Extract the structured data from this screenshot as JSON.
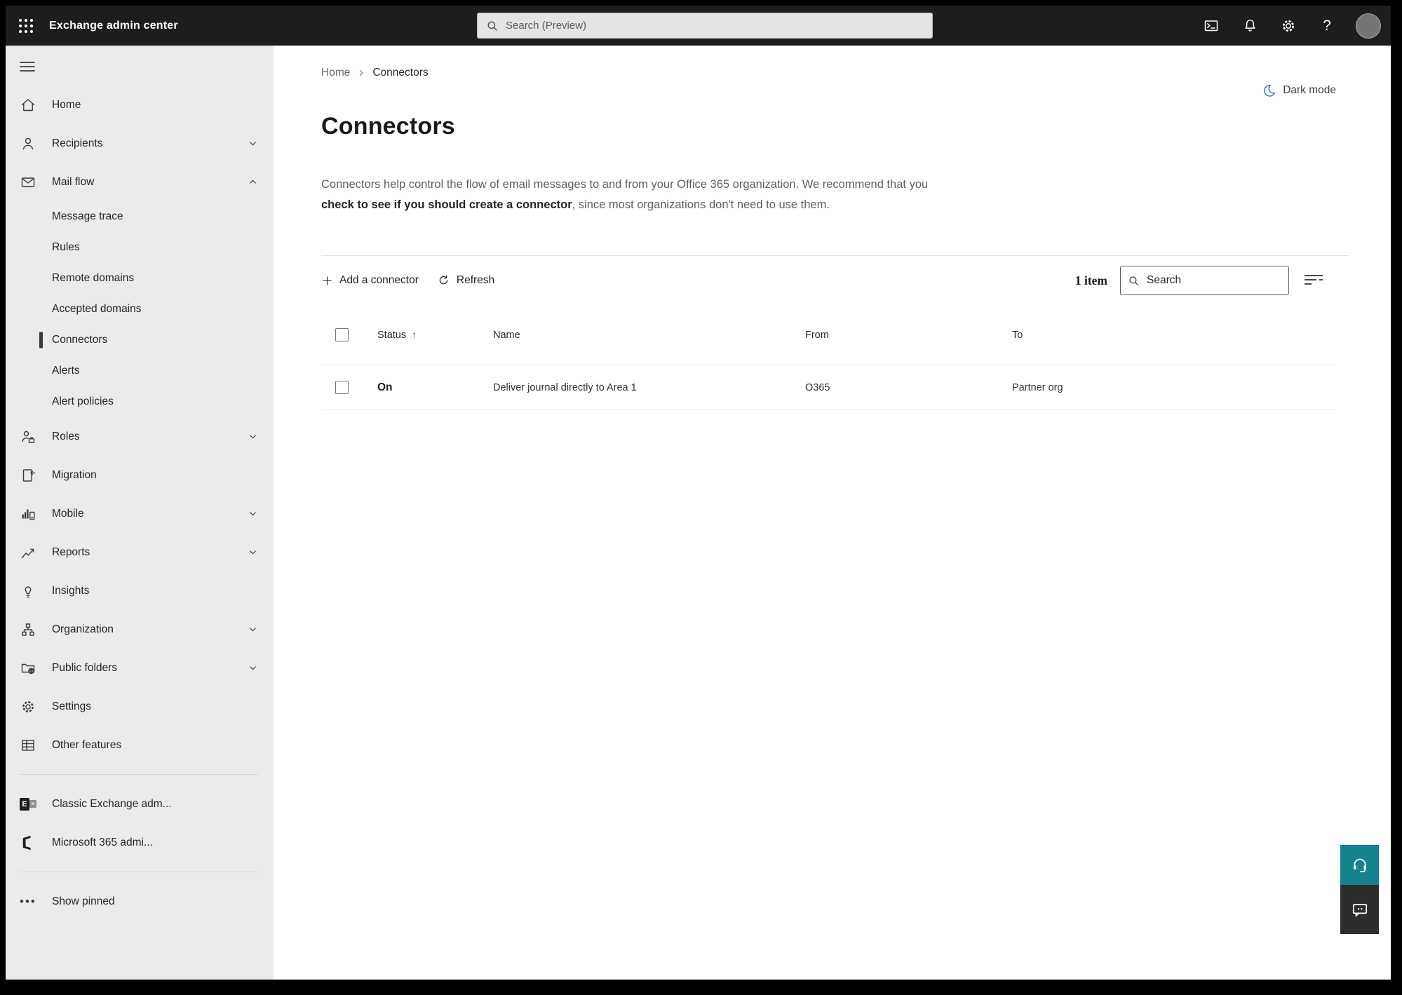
{
  "colors": {
    "topbar_bg": "#1d1d1d",
    "sidebar_bg": "#ebebeb",
    "selected_marker": "#3a3a3a",
    "accent_teal": "#13838e",
    "darkmode_blue": "#2f6fd6"
  },
  "topbar": {
    "title": "Exchange admin center",
    "search_placeholder": "Search (Preview)",
    "help_glyph": "?"
  },
  "sidebar": {
    "items": [
      {
        "label": "Home"
      },
      {
        "label": "Recipients"
      },
      {
        "label": "Mail flow"
      },
      {
        "label": "Message trace"
      },
      {
        "label": "Rules"
      },
      {
        "label": "Remote domains"
      },
      {
        "label": "Accepted domains"
      },
      {
        "label": "Connectors",
        "selected": true
      },
      {
        "label": "Alerts"
      },
      {
        "label": "Alert policies"
      },
      {
        "label": "Roles"
      },
      {
        "label": "Migration"
      },
      {
        "label": "Mobile"
      },
      {
        "label": "Reports"
      },
      {
        "label": "Insights"
      },
      {
        "label": "Organization"
      },
      {
        "label": "Public folders"
      },
      {
        "label": "Settings"
      },
      {
        "label": "Other features"
      },
      {
        "label": "Classic Exchange adm..."
      },
      {
        "label": "Microsoft 365 admi..."
      },
      {
        "label": "Show pinned"
      }
    ]
  },
  "breadcrumb": {
    "home": "Home",
    "current": "Connectors"
  },
  "dark_mode": {
    "label": "Dark mode"
  },
  "page": {
    "title": "Connectors",
    "description_1": "Connectors help control the flow of email messages to and from your Office 365 organization. We recommend that you ",
    "description_link": "check to see if you should create a connector",
    "description_2": ", since most organizations don't need to use them."
  },
  "toolbar": {
    "add_label": "Add a connector",
    "refresh_label": "Refresh",
    "item_count": "1 item",
    "search_placeholder": "Search"
  },
  "table": {
    "sort_glyph": "↑",
    "headers": {
      "status": "Status",
      "name": "Name",
      "from": "From",
      "to": "To"
    },
    "rows": [
      {
        "status": "On",
        "name": "Deliver journal directly to Area 1",
        "from": "O365",
        "to": "Partner org"
      }
    ]
  }
}
